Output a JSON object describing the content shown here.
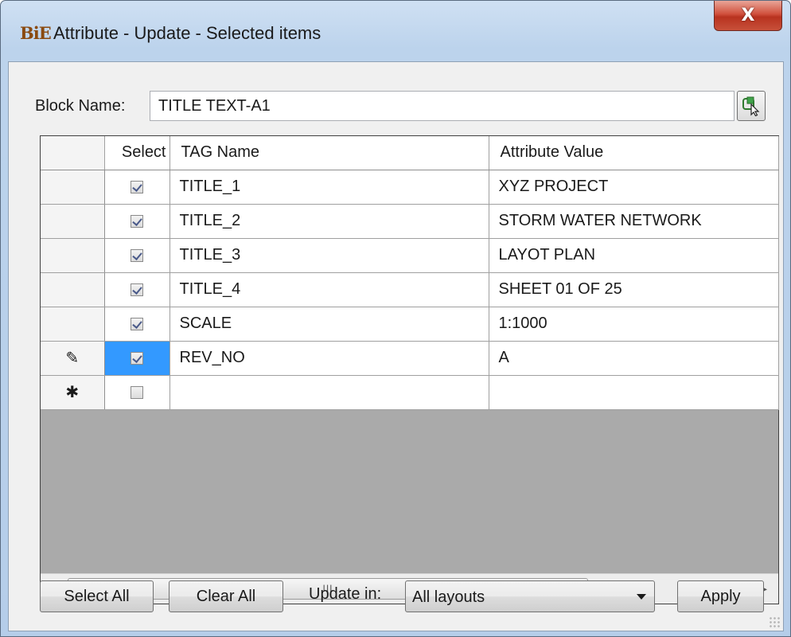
{
  "window": {
    "icon_text": "BiE",
    "title": "Attribute - Update - Selected items",
    "close_glyph": "X"
  },
  "block": {
    "label": "Block Name:",
    "value": "TITLE TEXT-A1",
    "pick_icon": "select-object-icon"
  },
  "grid": {
    "columns": [
      "Select",
      "TAG Name",
      "Attribute Value"
    ],
    "rows": [
      {
        "row_header": "",
        "selected": true,
        "tag": "TITLE_1",
        "value": "XYZ PROJECT"
      },
      {
        "row_header": "",
        "selected": true,
        "tag": "TITLE_2",
        "value": "STORM WATER NETWORK"
      },
      {
        "row_header": "",
        "selected": true,
        "tag": "TITLE_3",
        "value": "LAYOT PLAN"
      },
      {
        "row_header": "",
        "selected": true,
        "tag": "TITLE_4",
        "value": "SHEET 01 OF 25"
      },
      {
        "row_header": "",
        "selected": true,
        "tag": "SCALE",
        "value": "1:1000"
      },
      {
        "row_header": "✎",
        "selected": true,
        "tag": "REV_NO",
        "value": "A",
        "current": true
      },
      {
        "row_header": "✱",
        "selected": false,
        "tag": "",
        "value": ""
      }
    ],
    "scrollbar": {
      "left_arrow": "◂",
      "right_arrow": "▸",
      "thumb_grip": "III"
    }
  },
  "actions": {
    "select_all": "Select All",
    "clear_all": "Clear All",
    "update_in_label": "Update in:",
    "update_in_value": "All layouts",
    "apply": "Apply"
  },
  "colors": {
    "selection": "#3399ff",
    "grid_empty_area": "#aaaaaa"
  }
}
